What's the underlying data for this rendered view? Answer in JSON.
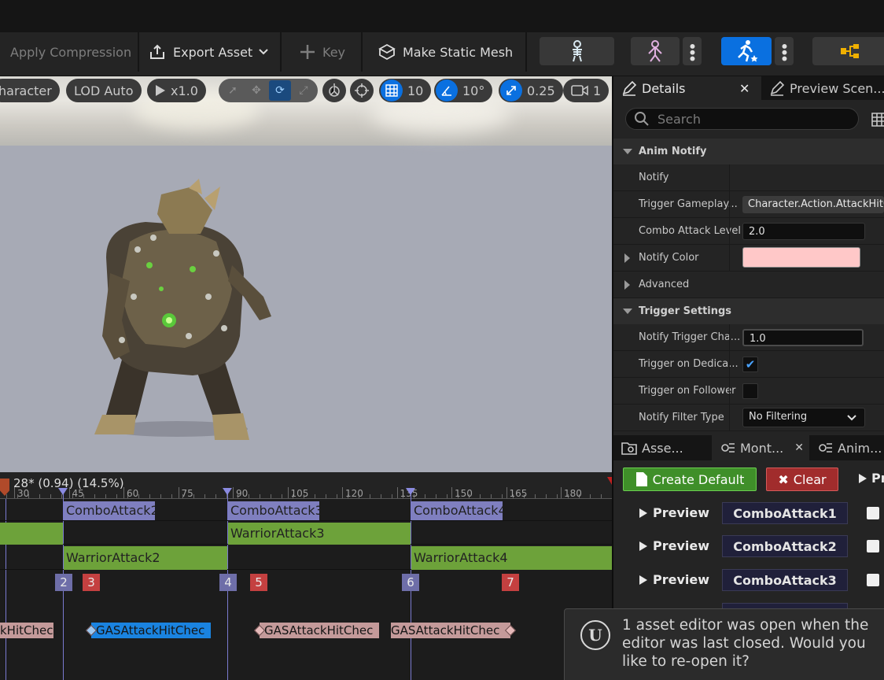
{
  "toolbar": {
    "apply_compression": "Apply Compression",
    "export_asset": "Export Asset",
    "key": "Key",
    "make_static_mesh": "Make Static Mesh"
  },
  "viewport": {
    "character_label": "haracter",
    "lod_label": "LOD Auto",
    "play_speed": "x1.0",
    "grid_snap": "10",
    "rotation_snap": "10°",
    "scale_snap": "0.25",
    "camera_speed": "1"
  },
  "timeline": {
    "frame_readout": "28* (0.94) (14.5%)",
    "ruler_labels": [
      "30",
      "45",
      "60",
      "75",
      "90",
      "105",
      "120",
      "135",
      "150",
      "165",
      "180"
    ],
    "montage_sections": [
      "ComboAttack2",
      "ComboAttack3",
      "ComboAttack4"
    ],
    "anim_segments_row1": [
      "WarriorAttack3"
    ],
    "anim_segments_row2": [
      "WarriorAttack2",
      "WarriorAttack4"
    ],
    "markers": [
      "2",
      "3",
      "4",
      "5",
      "6",
      "7"
    ],
    "notifies": [
      "kHitChec",
      "GASAttackHitChec",
      "GASAttackHitChec",
      "GASAttackHitChec"
    ]
  },
  "details": {
    "tabs": [
      "Details",
      "Preview Scen..."
    ],
    "search_placeholder": "Search",
    "sections": {
      "anim_notify": "Anim Notify",
      "trigger_settings": "Trigger Settings"
    },
    "props": {
      "notify": "Notify",
      "trigger_gameplay": "Trigger Gameplay...",
      "trigger_gameplay_value": "Character.Action.AttackHitCh",
      "combo_attack_level": "Combo Attack Level",
      "combo_attack_level_value": "2.0",
      "notify_color": "Notify Color",
      "notify_color_value": "#ffc8c8",
      "advanced": "Advanced",
      "notify_trigger_chance": "Notify Trigger Cha...",
      "notify_trigger_chance_value": "1.0",
      "trigger_on_dedicated": "Trigger on Dedica...",
      "trigger_on_follower": "Trigger on Follower",
      "notify_filter_type": "Notify Filter Type",
      "notify_filter_type_value": "No Filtering"
    }
  },
  "bottom_panel": {
    "tabs": [
      "Asse...",
      "Mont...",
      "Anim..."
    ],
    "create_default": "Create Default",
    "clear": "Clear",
    "pr": "Pr",
    "rows": [
      {
        "preview": "Preview",
        "name": "ComboAttack1"
      },
      {
        "preview": "Preview",
        "name": "ComboAttack2"
      },
      {
        "preview": "Preview",
        "name": "ComboAttack3"
      }
    ]
  },
  "toast": {
    "message": "1 asset editor was open when the editor was last closed. Would you like to re-open it?"
  },
  "colors": {
    "accent": "#0a70e0",
    "section_purple": "#7f7fbf",
    "segment_green": "#6da23a",
    "marker_red": "#c44040"
  }
}
